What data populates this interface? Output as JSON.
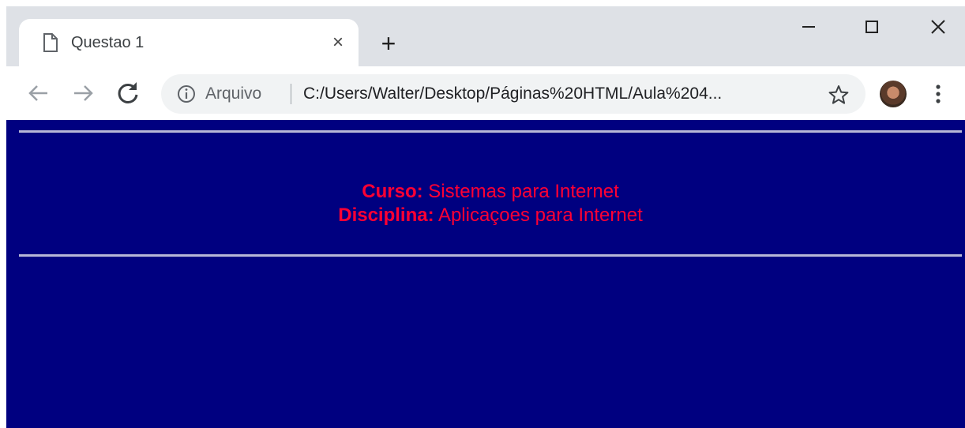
{
  "browser": {
    "tab": {
      "title": "Questao 1",
      "close_label": "×"
    },
    "new_tab_label": "+",
    "window_controls": {
      "minimize": "minimize-icon",
      "maximize": "maximize-icon",
      "close": "close-icon"
    },
    "address_bar": {
      "chip": "Arquivo",
      "url": "C:/Users/Walter/Desktop/Páginas%20HTML/Aula%204..."
    }
  },
  "page": {
    "background_color": "#000080",
    "text_color": "#ff0033",
    "rule_color": "#b7b7d7",
    "course_label": "Curso:",
    "course_value": " Sistemas para Internet",
    "discipline_label": "Disciplina:",
    "discipline_value": " Aplicaçoes para Internet"
  }
}
